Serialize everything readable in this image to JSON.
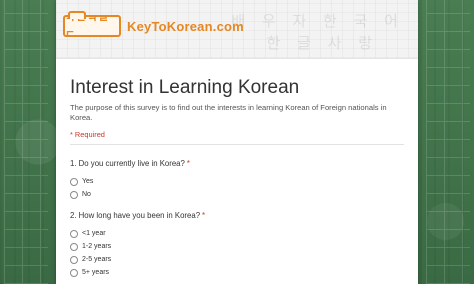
{
  "header": {
    "logo_mark": "ㅋㅌㅋㄹㄷ",
    "logo_text": "KeyToKorean.com",
    "watermark_line1": "배 우 자 한 국 어",
    "watermark_line2": "한 글 사 랑"
  },
  "form": {
    "title": "Interest in Learning Korean",
    "description": "The purpose of this survey is to find out the interests in learning Korean of Foreign nationals in Korea.",
    "required_note": "* Required"
  },
  "questions": [
    {
      "title": "1. Do you currently live in Korea?",
      "required_mark": "*",
      "options": [
        "Yes",
        "No"
      ]
    },
    {
      "title": "2. How long have you been in Korea?",
      "required_mark": "*",
      "options": [
        "<1 year",
        "1-2 years",
        "2-5 years",
        "5+ years"
      ]
    }
  ],
  "colors": {
    "brand": "#e58722",
    "background": "#3e6f47",
    "required": "#c53929"
  }
}
